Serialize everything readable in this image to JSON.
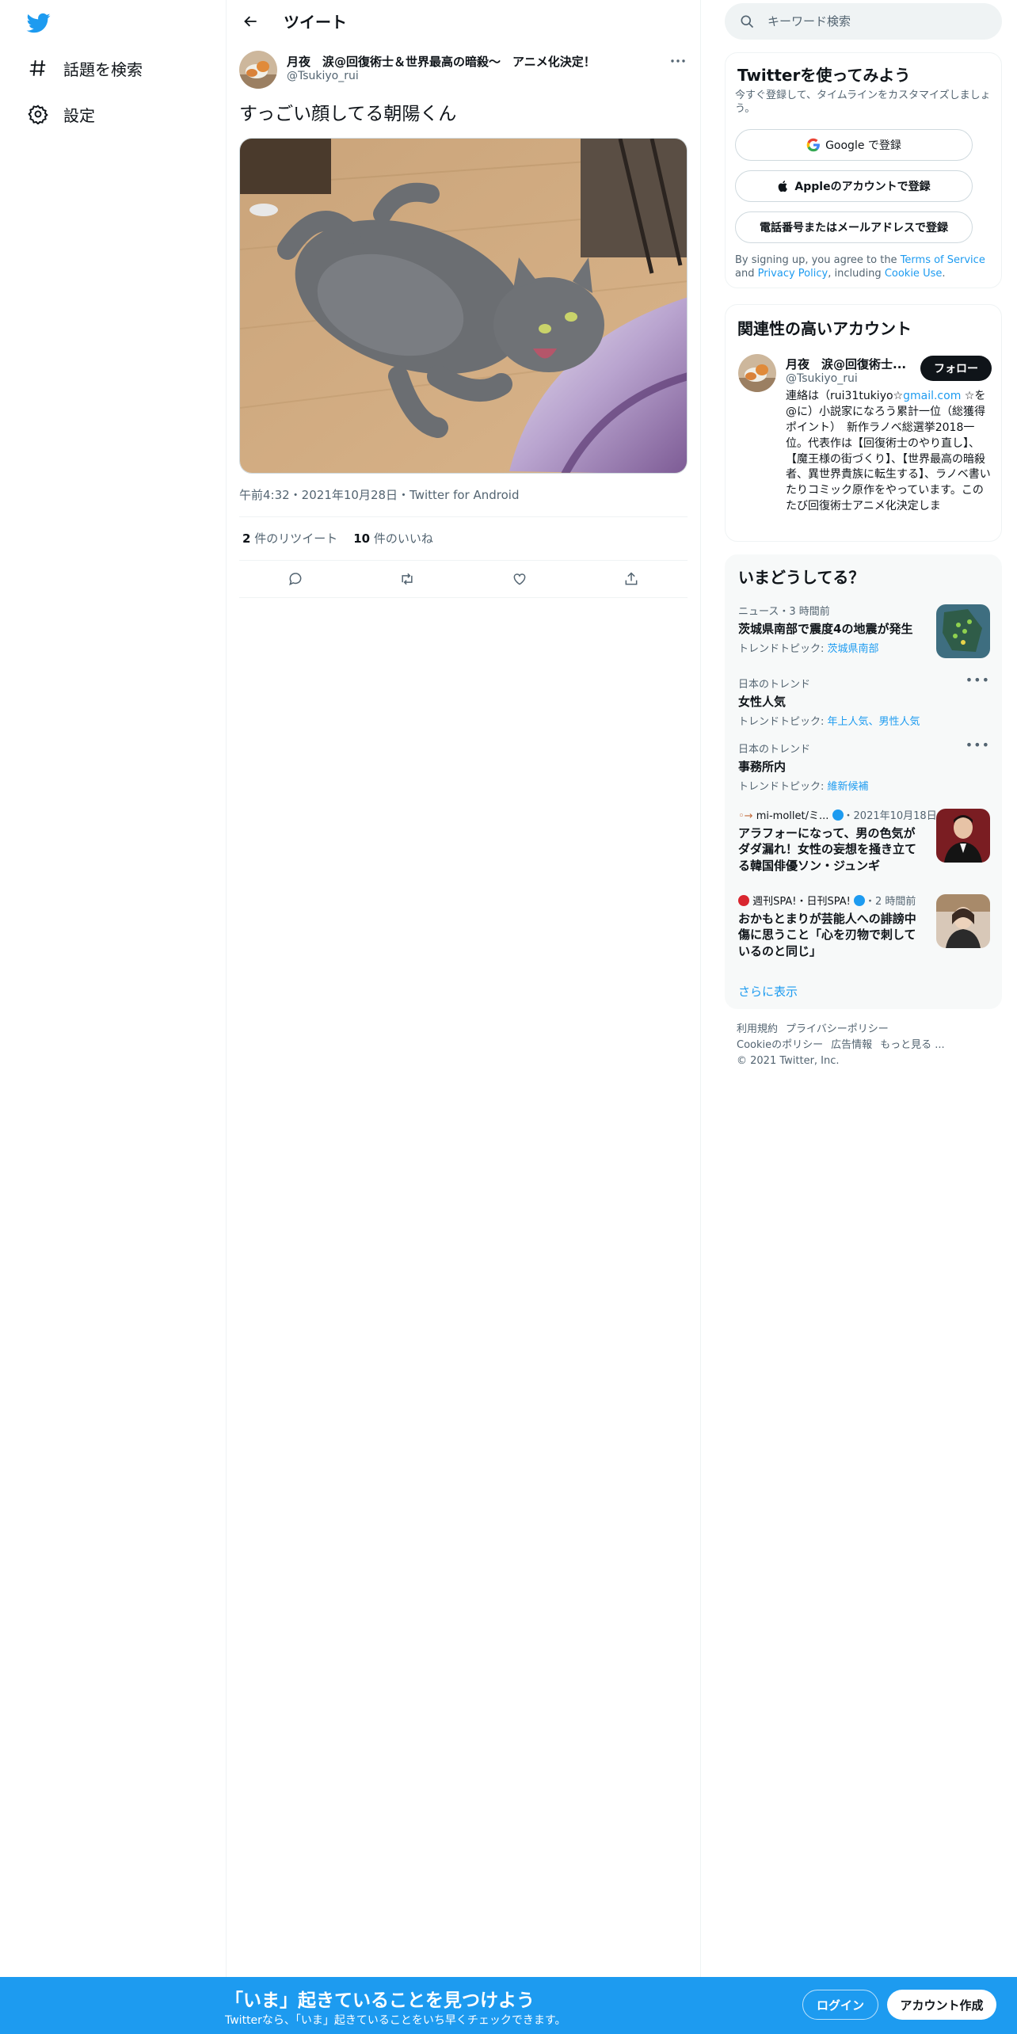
{
  "sidebar": {
    "items": [
      {
        "label": "話題を検索",
        "icon": "hashtag-icon"
      },
      {
        "label": "設定",
        "icon": "gear-icon"
      }
    ]
  },
  "header": {
    "title": "ツイート"
  },
  "tweet": {
    "author_name": "月夜　涙@回復術士＆世界最高の暗殺～　アニメ化決定！",
    "author_handle": "@Tsukiyo_rui",
    "text": "すっごい顔してる朝陽くん",
    "meta": "午前4:32・2021年10月28日・Twitter for Android",
    "retweets_count": "2",
    "retweets_label": " 件のリツイート",
    "likes_count": "10",
    "likes_label": " 件のいいね"
  },
  "search": {
    "placeholder": "キーワード検索"
  },
  "signup": {
    "title": "Twitterを使ってみよう",
    "subtitle": "今すぐ登録して、タイムラインをカスタマイズしましょう。",
    "google": "Google で登録",
    "apple": "Appleのアカウントで登録",
    "phone": "電話番号またはメールアドレスで登録",
    "terms_prefix": "By signing up, you agree to the ",
    "terms_link": "Terms of Service",
    "terms_and": " and ",
    "privacy_link": "Privacy Policy",
    "terms_including": ", including ",
    "cookie_link": "Cookie Use",
    "terms_end": "."
  },
  "relevant": {
    "title": "関連性の高いアカウント",
    "name": "月夜　涙@回復術士...",
    "handle": "@Tsukiyo_rui",
    "follow": "フォロー",
    "bio_prefix": "連絡は（rui31tukiyo☆",
    "bio_link": "gmail.com",
    "bio_rest": " ☆を@に）小説家になろう累計一位（総獲得ポイント）　新作ラノベ総選挙2018一位。代表作は【回復術士のやり直し】、【魔王様の街づくり】、【世界最高の暗殺者、異世界貴族に転生する】、ラノベ書いたりコミック原作をやっています。このたび回復術士アニメ化決定しま"
  },
  "trends": {
    "title": "いまどうしてる？",
    "items": [
      {
        "meta": "ニュース・3 時間前",
        "name": "茨城県南部で震度4の地震が発生",
        "topic_label": "トレンドトピック: ",
        "topic_links": "茨城県南部"
      },
      {
        "meta": "日本のトレンド",
        "name": "女性人気",
        "topic_label": "トレンドトピック: ",
        "topic_links": "年上人気、男性人気"
      },
      {
        "meta": "日本のトレンド",
        "name": "事務所内",
        "topic_label": "トレンドトピック: ",
        "topic_links": "維新候補"
      },
      {
        "source": "mi-mollet/ミ...",
        "time": "・2021年10月18日",
        "name": "アラフォーになって、男の色気がダダ漏れ！女性の妄想を掻き立てる韓国俳優ソン・ジュンギ"
      },
      {
        "source": "週刊SPA!・日刊SPA!",
        "time": "・2 時間前",
        "name": "おかもとまりが芸能人への誹謗中傷に思うこと「心を刃物で刺しているのと同じ」"
      }
    ],
    "show_more": "さらに表示"
  },
  "footer": {
    "terms": "利用規約",
    "privacy": "プライバシーポリシー",
    "cookie": "Cookieのポリシー",
    "ads": "広告情報",
    "more": "もっと見る ...",
    "copyright": "© 2021 Twitter, Inc."
  },
  "bottom_bar": {
    "title": "「いま」起きていることを見つけよう",
    "subtitle": "Twitterなら、「いま」起きていることをいち早くチェックできます。",
    "login": "ログイン",
    "signup": "アカウント作成"
  },
  "colors": {
    "accent": "#1d9bf0",
    "text": "#0f1419",
    "secondary": "#536471"
  }
}
